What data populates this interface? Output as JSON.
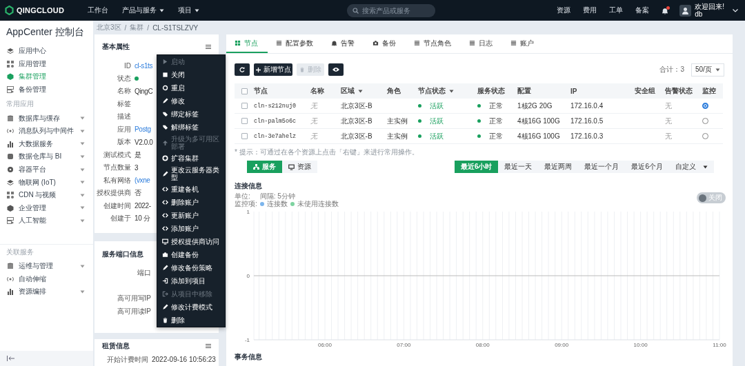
{
  "topbar": {
    "logo": "QINGCLOUD",
    "nav": [
      {
        "label": "工作台",
        "dropdown": false
      },
      {
        "label": "产品与服务",
        "dropdown": true
      },
      {
        "label": "项目",
        "dropdown": true
      }
    ],
    "search": {
      "placeholder": "搜索产品或服务"
    },
    "links": [
      "资源",
      "费用",
      "工单",
      "备案"
    ],
    "notifications": {
      "unread": true
    },
    "user": {
      "greeting": "欢迎回来!",
      "name": "db"
    }
  },
  "sidebar": {
    "title": "AppCenter 控制台",
    "sections": [
      {
        "items": [
          {
            "label": "应用中心",
            "selected": false,
            "expandable": false
          },
          {
            "label": "应用管理",
            "selected": false,
            "expandable": false
          },
          {
            "label": "集群管理",
            "selected": true,
            "expandable": false
          },
          {
            "label": "备份管理",
            "selected": false,
            "expandable": false
          }
        ]
      },
      {
        "heading": "常用应用",
        "items": [
          {
            "label": "数据库与缓存",
            "selected": false,
            "expandable": true
          },
          {
            "label": "消息队列与中间件",
            "selected": false,
            "expandable": true
          },
          {
            "label": "大数据服务",
            "selected": false,
            "expandable": true
          },
          {
            "label": "数据仓库与 BI",
            "selected": false,
            "expandable": true
          },
          {
            "label": "容器平台",
            "selected": false,
            "expandable": true
          },
          {
            "label": "物联网 (IoT)",
            "selected": false,
            "expandable": true
          },
          {
            "label": "CDN 与视频",
            "selected": false,
            "expandable": true
          },
          {
            "label": "企业管理",
            "selected": false,
            "expandable": true
          },
          {
            "label": "人工智能",
            "selected": false,
            "expandable": true
          }
        ]
      },
      {
        "heading": "关联服务",
        "items": [
          {
            "label": "运维与管理",
            "selected": false,
            "expandable": true
          },
          {
            "label": "自动伸缩",
            "selected": false,
            "expandable": false
          },
          {
            "label": "资源编排",
            "selected": false,
            "expandable": true
          }
        ]
      }
    ]
  },
  "breadcrumb": [
    {
      "label": "北京3区",
      "kind": "link"
    },
    {
      "label": "/",
      "kind": "separator"
    },
    {
      "label": "集群",
      "kind": "link"
    },
    {
      "label": "/",
      "kind": "separator"
    },
    {
      "label": "CL-S1TSLZVY",
      "kind": "current"
    }
  ],
  "basic_properties": {
    "title": "基本属性",
    "fields": [
      {
        "label": "ID",
        "kind": "link",
        "value": "cl-s1ts"
      },
      {
        "label": "状态",
        "kind": "status"
      },
      {
        "label": "名称",
        "kind": "text",
        "value": "QingC"
      },
      {
        "label": "标签",
        "kind": "text"
      },
      {
        "label": "描述",
        "kind": "text"
      },
      {
        "label": "应用",
        "kind": "link",
        "value": "Postg"
      },
      {
        "label": "版本",
        "kind": "text",
        "value": "V2.0.0"
      },
      {
        "label": "测试模式",
        "kind": "text",
        "value": "是"
      },
      {
        "label": "节点数量",
        "kind": "text",
        "value": "3"
      },
      {
        "label": "私有网络",
        "kind": "link",
        "value": "(vxne"
      },
      {
        "label": "授权提供商",
        "kind": "text",
        "value": "否"
      },
      {
        "label": "创建时间",
        "kind": "text",
        "value": "2022-"
      },
      {
        "label": "创建于",
        "kind": "text",
        "value": "10 分"
      }
    ]
  },
  "service_ports": {
    "title": "服务端口信息",
    "fields": [
      {
        "label": "端口"
      },
      {
        "label": "高可用写IP"
      },
      {
        "label": "高可用读IP"
      }
    ]
  },
  "lease": {
    "title": "租赁信息",
    "fields": [
      {
        "label": "开始计费时间",
        "value": "2022-09-16 10:56:23"
      }
    ]
  },
  "context_menu": [
    {
      "label": "启动",
      "kind": "play",
      "disabled": true
    },
    {
      "label": "关闭",
      "kind": "stop",
      "disabled": false
    },
    {
      "label": "重启",
      "kind": "restart",
      "disabled": false
    },
    {
      "label": "修改",
      "kind": "edit",
      "disabled": false
    },
    {
      "label": "绑定标签",
      "kind": "tag",
      "disabled": false
    },
    {
      "label": "解绑标签",
      "kind": "tag",
      "disabled": false
    },
    {
      "label": "升级为多可用区部署",
      "kind": "upgrade",
      "disabled": true
    },
    {
      "label": "扩容集群",
      "kind": "gear",
      "disabled": false
    },
    {
      "label": "更改云服务器类型",
      "kind": "edit",
      "disabled": false
    },
    {
      "label": "重建备机",
      "kind": "code",
      "disabled": false
    },
    {
      "label": "删除账户",
      "kind": "code",
      "disabled": false
    },
    {
      "label": "更新账户",
      "kind": "code",
      "disabled": false
    },
    {
      "label": "添加账户",
      "kind": "code",
      "disabled": false
    },
    {
      "label": "授权提供商访问",
      "kind": "monitor",
      "disabled": false
    },
    {
      "label": "创建备份",
      "kind": "camera",
      "disabled": false
    },
    {
      "label": "修改备份策略",
      "kind": "edit",
      "disabled": false
    },
    {
      "label": "添加到项目",
      "kind": "enter",
      "disabled": false
    },
    {
      "label": "从项目中移除",
      "kind": "exit",
      "disabled": true
    },
    {
      "label": "修改计费模式",
      "kind": "edit",
      "disabled": false
    },
    {
      "label": "删除",
      "kind": "trash",
      "disabled": false
    }
  ],
  "main": {
    "tabs": [
      {
        "label": "节点",
        "kind": "grid",
        "selected": true
      },
      {
        "label": "配置参数",
        "kind": "list",
        "selected": false
      },
      {
        "label": "告警",
        "kind": "bell",
        "selected": false
      },
      {
        "label": "备份",
        "kind": "camera",
        "selected": false
      },
      {
        "label": "节点角色",
        "kind": "list",
        "selected": false
      },
      {
        "label": "日志",
        "kind": "list",
        "selected": false
      },
      {
        "label": "账户",
        "kind": "list",
        "selected": false
      }
    ],
    "toolbar": [
      {
        "kind": "refresh",
        "disabled": false
      },
      {
        "kind": "add",
        "label": "新增节点",
        "disabled": false
      },
      {
        "kind": "delete",
        "label": "删除",
        "disabled": true
      },
      {
        "kind": "view",
        "disabled": false
      }
    ],
    "total": "合计：3",
    "page_size": "50/页",
    "table": {
      "select_all": {
        "checked": false
      },
      "columns": [
        {
          "label": "节点",
          "sortable": false
        },
        {
          "label": "名称",
          "sortable": false
        },
        {
          "label": "区域",
          "sortable": true
        },
        {
          "label": "角色",
          "sortable": false
        },
        {
          "label": "节点状态",
          "sortable": true
        },
        {
          "label": "服务状态",
          "sortable": false
        },
        {
          "label": "配置",
          "sortable": false
        },
        {
          "label": "IP",
          "sortable": false
        },
        {
          "label": "安全组",
          "sortable": false
        },
        {
          "label": "告警状态",
          "sortable": false
        },
        {
          "label": "监控",
          "sortable": false
        }
      ],
      "rows": [
        {
          "checked": false,
          "node": "cln-s212nuj0",
          "name": "无",
          "zone": "北京3区-B",
          "node_status": "活跃",
          "service_status": "正常",
          "config": "1核2G 20G",
          "ip": "172.16.0.4",
          "alert": "无",
          "selected": true
        },
        {
          "checked": false,
          "node": "cln-palm5o6c",
          "name": "无",
          "zone": "北京3区-B",
          "role": "主实例",
          "node_status": "活跃",
          "service_status": "正常",
          "config": "4核16G 100G",
          "ip": "172.16.0.5",
          "alert": "无",
          "selected": false
        },
        {
          "checked": false,
          "node": "cln-3e7ahelz",
          "name": "无",
          "zone": "北京3区-B",
          "role": "主实例",
          "node_status": "活跃",
          "service_status": "正常",
          "config": "4核16G 100G",
          "ip": "172.16.0.3",
          "alert": "无",
          "selected": false
        }
      ]
    },
    "hint": "* 提示：可通过在各个资源上点击「右键」来进行常用操作。",
    "view_switch": [
      {
        "label": "服务",
        "kind": "service",
        "selected": true
      },
      {
        "label": "资源",
        "kind": "resource",
        "selected": false
      }
    ],
    "time_ranges": [
      {
        "label": "最近6小时",
        "selected": true,
        "dropdown": false
      },
      {
        "label": "最近一天",
        "selected": false,
        "dropdown": false
      },
      {
        "label": "最近两周",
        "selected": false,
        "dropdown": false
      },
      {
        "label": "最近一个月",
        "selected": false,
        "dropdown": false
      },
      {
        "label": "最近6个月",
        "selected": false,
        "dropdown": false
      },
      {
        "label": "自定义",
        "selected": false,
        "dropdown": true
      }
    ],
    "connection": {
      "title": "连接信息",
      "unit": "单位:",
      "interval": "间隔: 5分钟",
      "legend_label": "监控项:",
      "legend": [
        {
          "label": "连接数",
          "color": "#7cb5ec"
        },
        {
          "label": "未使用连接数",
          "color": "#7ed3a0"
        }
      ],
      "toggle": {
        "label": "关闭",
        "on": false
      },
      "chart_data": {
        "type": "line",
        "grid": true,
        "xlim": [
          5.1,
          11
        ],
        "ylim": [
          -1,
          1
        ],
        "xticks": [
          {
            "value": 6,
            "label": "06:00"
          },
          {
            "value": 7,
            "label": "07:00"
          },
          {
            "value": 8,
            "label": "08:00"
          },
          {
            "value": 9,
            "label": "09:00"
          },
          {
            "value": 10,
            "label": "10:00"
          },
          {
            "value": 11,
            "label": "11:00"
          }
        ],
        "yticks": [
          -1,
          0,
          1
        ]
      }
    },
    "next_section": "事务信息"
  }
}
